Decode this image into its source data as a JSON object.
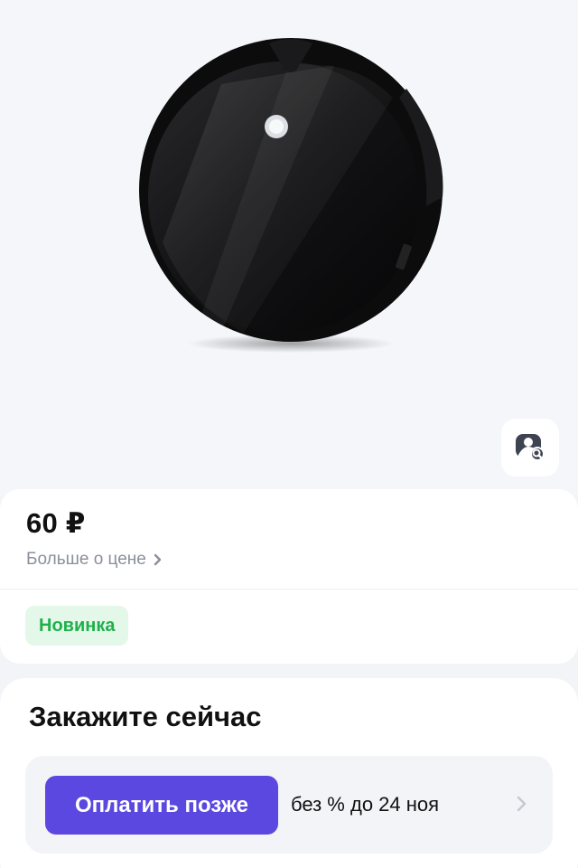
{
  "product": {
    "image_alt_icon": "robot-vacuum-image",
    "visual_search_icon": "image-search-icon"
  },
  "price_block": {
    "price": "60 ₽",
    "more_about_price": "Больше о цене",
    "badge": "Новинка",
    "badge_color": "#20b04b",
    "badge_bg": "#e4f8ea"
  },
  "order_block": {
    "title": "Закажите сейчас",
    "pay_later_label": "Оплатить позже",
    "pay_later_terms": "без % до 24 ноя",
    "accent_color": "#5b48e0"
  }
}
